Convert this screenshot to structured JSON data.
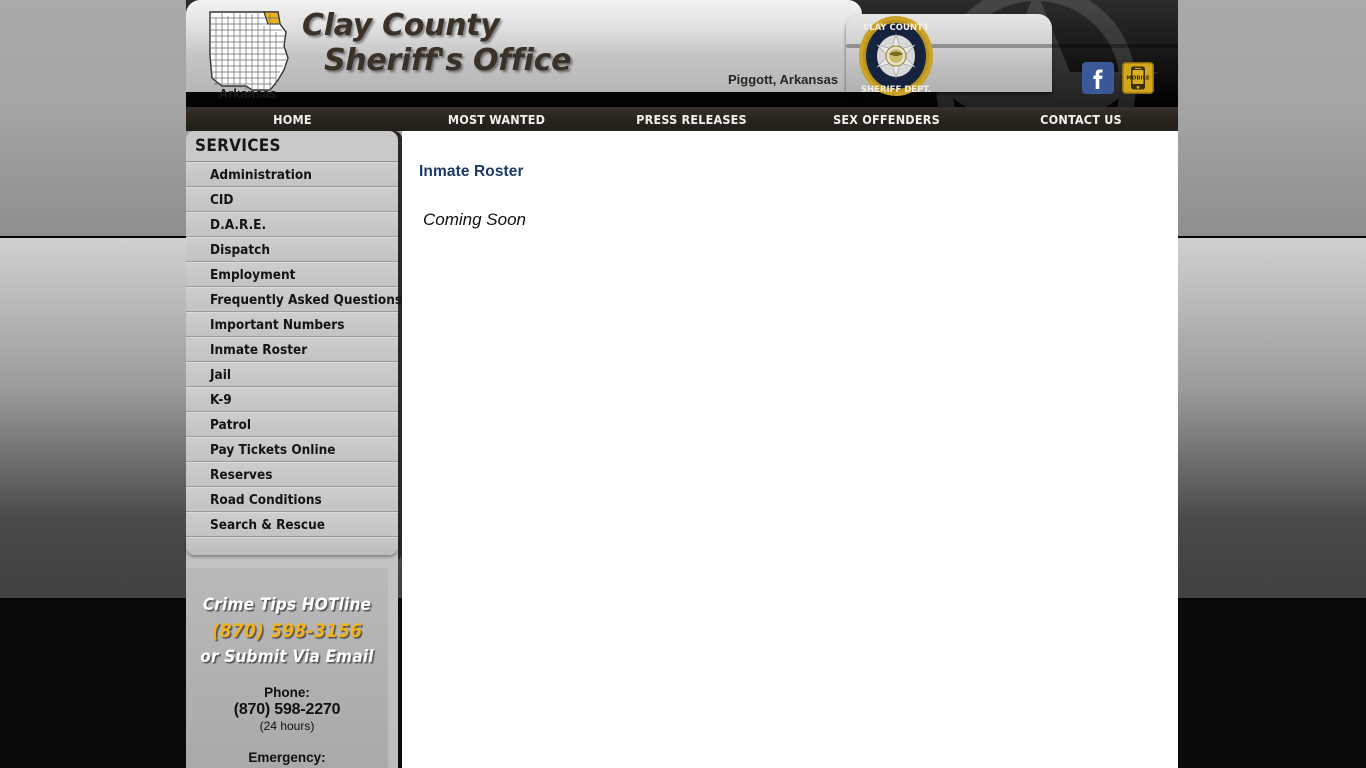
{
  "site": {
    "title_line1": "Clay County",
    "title_line2": "Sheriff's Office",
    "city": "Piggott, Arkansas",
    "state_label": "Arkansas",
    "badge_top_text": "CLAY COUNTY",
    "badge_bottom_text": "SHERIFF DEPT."
  },
  "colors": {
    "nav_bar": "#2a251f",
    "title_text": "#3a3229",
    "heading_blue": "#1b3a66",
    "hotline_gold": "#f0b21e",
    "facebook_blue": "#3b5998",
    "mobile_gold": "#d2a61b",
    "county_highlight": "#e8b321"
  },
  "social": [
    {
      "name": "facebook-icon",
      "label": "f"
    },
    {
      "name": "mobile-icon",
      "label": "MOBILE"
    }
  ],
  "nav": {
    "items": [
      {
        "label": "HOME"
      },
      {
        "label": "MOST WANTED"
      },
      {
        "label": "PRESS RELEASES"
      },
      {
        "label": "SEX OFFENDERS"
      },
      {
        "label": "CONTACT US"
      }
    ]
  },
  "sidebar": {
    "heading": "SERVICES",
    "items": [
      {
        "label": "Administration"
      },
      {
        "label": "CID"
      },
      {
        "label": "D.A.R.E."
      },
      {
        "label": "Dispatch"
      },
      {
        "label": "Employment"
      },
      {
        "label": "Frequently Asked Questions"
      },
      {
        "label": "Important Numbers"
      },
      {
        "label": "Inmate Roster"
      },
      {
        "label": "Jail"
      },
      {
        "label": "K-9"
      },
      {
        "label": "Patrol"
      },
      {
        "label": "Pay Tickets Online"
      },
      {
        "label": "Reserves"
      },
      {
        "label": "Road Conditions"
      },
      {
        "label": "Search & Rescue"
      }
    ]
  },
  "tips": {
    "line1": "Crime Tips HOTline",
    "phone": "(870) 598-3156",
    "line3": "or Submit Via Email",
    "contact": {
      "phone_label": "Phone:",
      "phone_number": "(870) 598-2270",
      "phone_note": "(24 hours)",
      "emergency_label": "Emergency:"
    }
  },
  "main": {
    "title": "Inmate Roster",
    "body": "Coming Soon"
  }
}
